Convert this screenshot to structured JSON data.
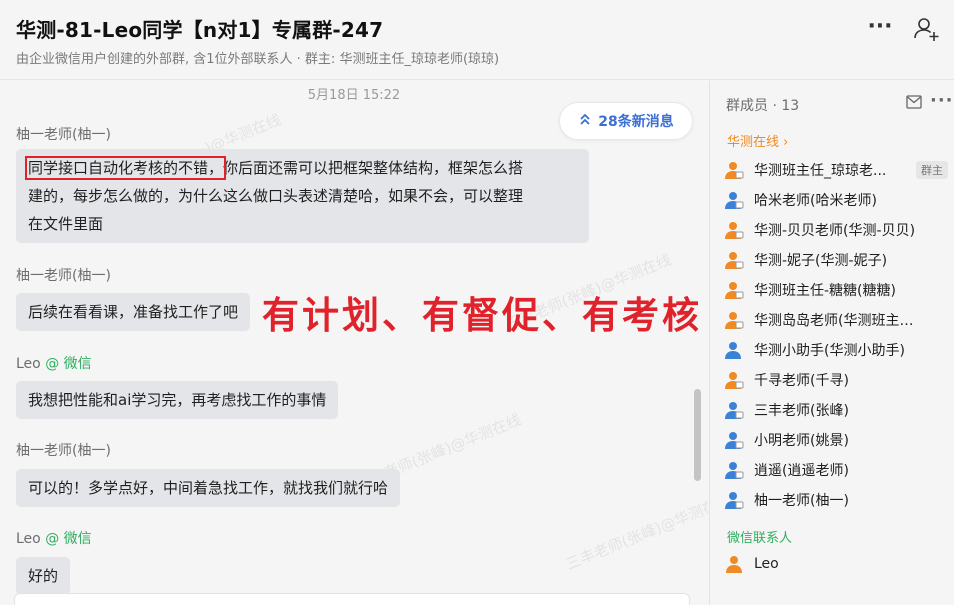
{
  "header": {
    "title": "华测-81-Leo同学【n对1】专属群-247",
    "subtitle": "由企业微信用户创建的外部群, 含1位外部联系人 · 群主: 华测班主任_琼琼老师(琼琼)",
    "more_icon": "more-icon",
    "add_icon": "add-member-icon"
  },
  "chat": {
    "timestamp": "5月18日 15:22",
    "new_messages": "28条新消息",
    "messages": [
      {
        "sender": "柚一老师(柚一)",
        "lines": [
          "同学接口自动化考核的不错，你后面还需可以把框架整体结构，框架怎么搭",
          "建的，每步怎么做的，为什么这么做口头表述清楚哈，如果不会，可以整理",
          "在文件里面"
        ],
        "highlight": "同学接口自动化考核的不错，",
        "rest_first_line": "你后面还需可以把框架整体结构，框架怎么搭"
      },
      {
        "sender": "柚一老师(柚一)",
        "text": "后续在看看课，准备找工作了吧"
      },
      {
        "sender": "Leo",
        "sender_tag": "@ 微信",
        "text": "我想把性能和ai学习完，再考虑找工作的事情"
      },
      {
        "sender": "柚一老师(柚一)",
        "text": "可以的！多学点好，中间着急找工作，就找我们就行哈"
      },
      {
        "sender": "Leo",
        "sender_tag": "@ 微信",
        "text": "好的"
      }
    ],
    "overlay": "有计划、有督促、有考核",
    "watermarks": [
      "柚一老师(柚一)@华测在线",
      "三丰老师(张峰)@华测在线",
      "三丰老师(张峰)@华测在线",
      "三丰老师(张峰)@华测在线"
    ]
  },
  "sidebar": {
    "members_label": "群成员 · 13",
    "section_huace": "华测在线",
    "section_wechat": "微信联系人",
    "owner_badge": "群主",
    "members": [
      {
        "name": "华测班主任_琼琼老...",
        "color": "#f08a24"
      },
      {
        "name": "哈米老师(哈米老师)",
        "color": "#3b82d6"
      },
      {
        "name": "华测-贝贝老师(华测-贝贝)",
        "color": "#f08a24"
      },
      {
        "name": "华测-妮子(华测-妮子)",
        "color": "#f08a24"
      },
      {
        "name": "华测班主任-糖糖(糖糖)",
        "color": "#f08a24"
      },
      {
        "name": "华测岛岛老师(华测班主任...",
        "color": "#f08a24"
      },
      {
        "name": "华测小助手(华测小助手)",
        "color": "#3b82d6"
      },
      {
        "name": "千寻老师(千寻)",
        "color": "#f08a24"
      },
      {
        "name": "三丰老师(张峰)",
        "color": "#3b82d6"
      },
      {
        "name": "小明老师(姚景)",
        "color": "#3b82d6"
      },
      {
        "name": "逍遥(逍遥老师)",
        "color": "#3b82d6"
      },
      {
        "name": "柚一老师(柚一)",
        "color": "#3b82d6"
      }
    ],
    "wechat_contact": {
      "name": "Leo",
      "color": "#f08a24"
    }
  }
}
